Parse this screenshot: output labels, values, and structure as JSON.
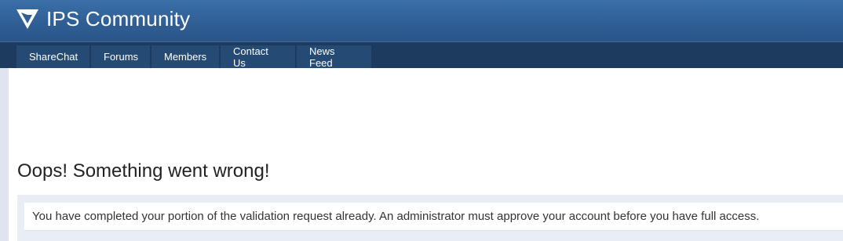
{
  "header": {
    "title": "IPS Community",
    "logo_icon": "ips-logo-icon",
    "bg_color": "#305f95"
  },
  "nav": {
    "tabs": [
      {
        "label": "ShareChat"
      },
      {
        "label": "Forums"
      },
      {
        "label": "Members"
      },
      {
        "label": "Contact Us"
      },
      {
        "label": "News Feed"
      }
    ],
    "bg_color": "#1d3b5f"
  },
  "error": {
    "title": "Oops! Something went wrong!",
    "message": "You have completed your portion of the validation request already. An administrator must approve your account before you have full access."
  }
}
